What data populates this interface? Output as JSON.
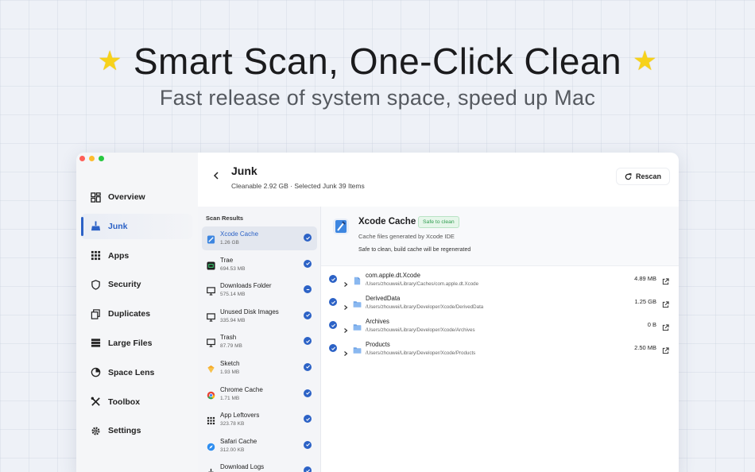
{
  "hero": {
    "title": "Smart Scan, One-Click Clean",
    "subtitle": "Fast release of system space, speed up Mac",
    "star": "★"
  },
  "sidebar": {
    "items": [
      {
        "label": "Overview",
        "icon": "overview-grid-icon"
      },
      {
        "label": "Junk",
        "icon": "broom-icon"
      },
      {
        "label": "Apps",
        "icon": "apps-grid-icon"
      },
      {
        "label": "Security",
        "icon": "shield-icon"
      },
      {
        "label": "Duplicates",
        "icon": "duplicates-icon"
      },
      {
        "label": "Large Files",
        "icon": "large-files-icon"
      },
      {
        "label": "Space Lens",
        "icon": "pie-chart-icon"
      },
      {
        "label": "Toolbox",
        "icon": "tools-icon"
      },
      {
        "label": "Settings",
        "icon": "gear-icon"
      }
    ],
    "active_index": 1
  },
  "header": {
    "title": "Junk",
    "meta": "Cleanable 2.92 GB · Selected Junk 39 Items",
    "rescan_label": "Rescan"
  },
  "scan": {
    "heading": "Scan Results",
    "items": [
      {
        "name": "Xcode Cache",
        "size": "1.26 GB",
        "state": "checked",
        "icon": "xcode-icon"
      },
      {
        "name": "Trae",
        "size": "694.53 MB",
        "state": "checked",
        "icon": "trae-icon"
      },
      {
        "name": "Downloads Folder",
        "size": "575.14 MB",
        "state": "partial",
        "icon": "monitor-icon"
      },
      {
        "name": "Unused Disk Images",
        "size": "335.94 MB",
        "state": "checked",
        "icon": "monitor-icon"
      },
      {
        "name": "Trash",
        "size": "87.79 MB",
        "state": "checked",
        "icon": "monitor-icon"
      },
      {
        "name": "Sketch",
        "size": "1.93 MB",
        "state": "checked",
        "icon": "sketch-icon"
      },
      {
        "name": "Chrome Cache",
        "size": "1.71 MB",
        "state": "checked",
        "icon": "chrome-icon"
      },
      {
        "name": "App Leftovers",
        "size": "323.78 KB",
        "state": "checked",
        "icon": "apps-grid-icon"
      },
      {
        "name": "Safari Cache",
        "size": "312.00 KB",
        "state": "checked",
        "icon": "safari-icon"
      },
      {
        "name": "Download Logs",
        "size": "",
        "state": "checked",
        "icon": "download-icon"
      }
    ]
  },
  "detail": {
    "title": "Xcode Cache",
    "badge": "Safe to clean",
    "subtitle": "Cache files generated by Xcode IDE",
    "note": "Safe to clean, build cache will be regenerated",
    "files": [
      {
        "name": "com.apple.dt.Xcode",
        "path": "/Users/zhouwei/Library/Caches/com.apple.dt.Xcode",
        "size": "4.89 MB",
        "kind": "file"
      },
      {
        "name": "DerivedData",
        "path": "/Users/zhouwei/Library/Developer/Xcode/DerivedData",
        "size": "1.25 GB",
        "kind": "folder"
      },
      {
        "name": "Archives",
        "path": "/Users/zhouwei/Library/Developer/Xcode/Archives",
        "size": "0 B",
        "kind": "folder"
      },
      {
        "name": "Products",
        "path": "/Users/zhouwei/Library/Developer/Xcode/Products",
        "size": "2.50 MB",
        "kind": "folder"
      }
    ]
  },
  "colors": {
    "accent": "#2c62c6",
    "safe_green": "#2f9c4f",
    "star_yellow": "#f7d21a"
  }
}
